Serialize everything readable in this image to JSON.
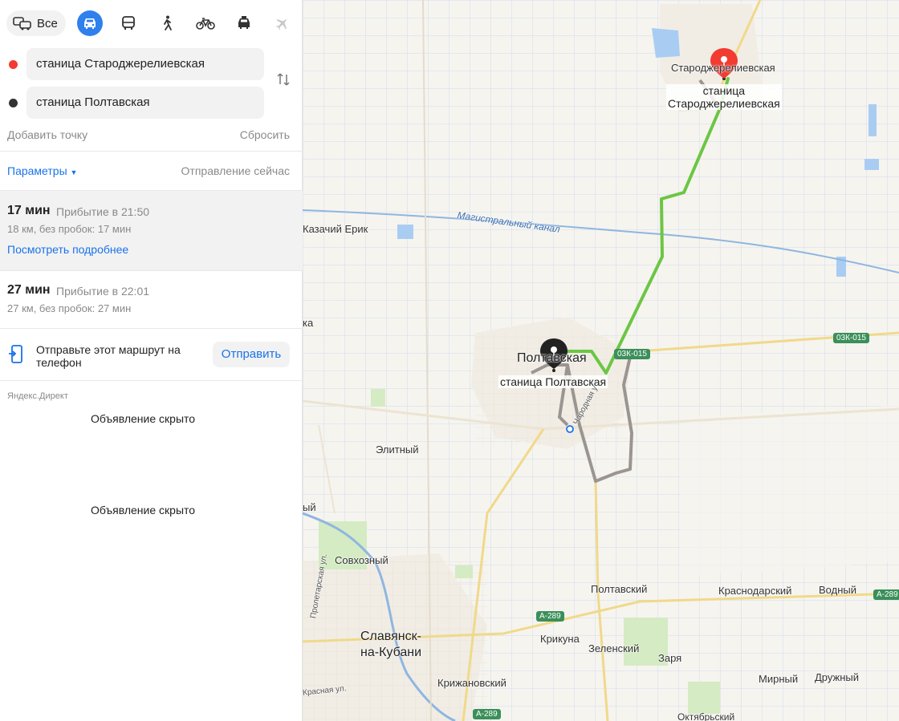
{
  "modes": {
    "all_label": "Все",
    "items": [
      {
        "id": "car",
        "icon": "car-icon",
        "active": true
      },
      {
        "id": "bus",
        "icon": "bus-icon",
        "active": false
      },
      {
        "id": "walk",
        "icon": "walk-icon",
        "active": false
      },
      {
        "id": "bike",
        "icon": "bike-icon",
        "active": false
      },
      {
        "id": "taxi",
        "icon": "taxi-icon",
        "active": false
      },
      {
        "id": "plane",
        "icon": "plane-icon",
        "active": false
      }
    ]
  },
  "points": {
    "from": {
      "value": "станица Староджерелиевская",
      "color": "#f23c32"
    },
    "to": {
      "value": "станица Полтавская",
      "color": "#333333"
    }
  },
  "actions": {
    "add_point": "Добавить точку",
    "reset": "Сбросить",
    "params": "Параметры",
    "departure": "Отправление сейчас"
  },
  "routes": [
    {
      "time": "17 мин",
      "arrival": "Прибытие в 21:50",
      "distance": "18 км, без пробок: 17 мин",
      "details_link": "Посмотреть подробнее",
      "selected": true
    },
    {
      "time": "27 мин",
      "arrival": "Прибытие в 22:01",
      "distance": "27 км, без пробок: 27 мин",
      "selected": false
    }
  ],
  "send": {
    "text": "Отправьте этот маршрут на телефон",
    "button": "Отправить"
  },
  "ads": {
    "label": "Яндекс.Директ",
    "hidden_1": "Объявление скрыто",
    "hidden_2": "Объявление скрыто"
  },
  "map": {
    "route_color_main": "#6cc644",
    "route_color_alt": "#9a9590",
    "origin_marker_color": "#f23c32",
    "destination_marker_color": "#222222",
    "labels": {
      "star_town": "Староджерелиевская",
      "star_stop_line1": "станица",
      "star_stop_line2": "Староджерелиевская",
      "kazachiy": "Казачий Ерик",
      "canal": "Магистральный канал",
      "poltava_town": "Полтавская",
      "poltava_stop": "станица Полтавская",
      "street": "Чародная у",
      "elitny": "Элитный",
      "sovkhozny": "Совхозный",
      "slavyansk_1": "Славянск-",
      "slavyansk_2": "на-Кубани",
      "krizhanovsky": "Крижановский",
      "krikuna": "Крикуна",
      "zelensky": "Зеленский",
      "zarya": "Заря",
      "poltavsky": "Полтавский",
      "krasnodarsky": "Краснодарский",
      "vodny": "Водный",
      "mirny": "Мирный",
      "druzhny": "Дружный",
      "oktyabrsky": "Октябрьский",
      "proletarskaya": "Пролетарская ул.",
      "krasnaya": "Красная ул.",
      "edge_ka": "ка",
      "edge_ny": "ый"
    },
    "shields": {
      "r1": "03К-015",
      "r2": "03К-015",
      "a289_1": "А-289",
      "a289_2": "А-289",
      "a289_3": "А-289"
    }
  }
}
